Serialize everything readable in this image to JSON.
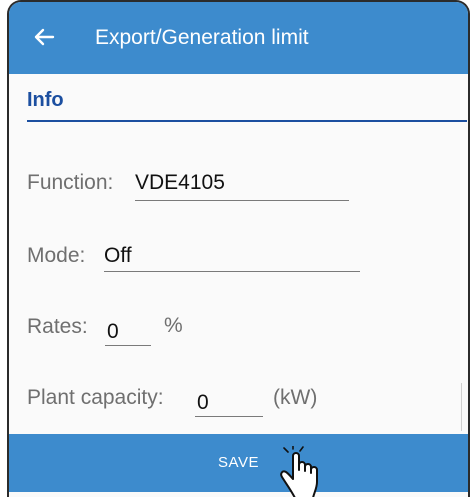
{
  "appbar": {
    "title": "Export/Generation limit",
    "back_icon": "arrow-left-icon",
    "color": "#3d8bcd"
  },
  "section": {
    "title": "Info",
    "color": "#1c4fa0"
  },
  "fields": {
    "function": {
      "label": "Function:",
      "value": "VDE4105"
    },
    "mode": {
      "label": "Mode:",
      "value": "Off"
    },
    "rates": {
      "label": "Rates:",
      "value": "0",
      "unit": "%"
    },
    "plant_capacity": {
      "label": "Plant capacity:",
      "value": "0",
      "unit": "(kW)"
    }
  },
  "actions": {
    "save_label": "SAVE",
    "cursor_icon": "hand-pointer-icon"
  }
}
